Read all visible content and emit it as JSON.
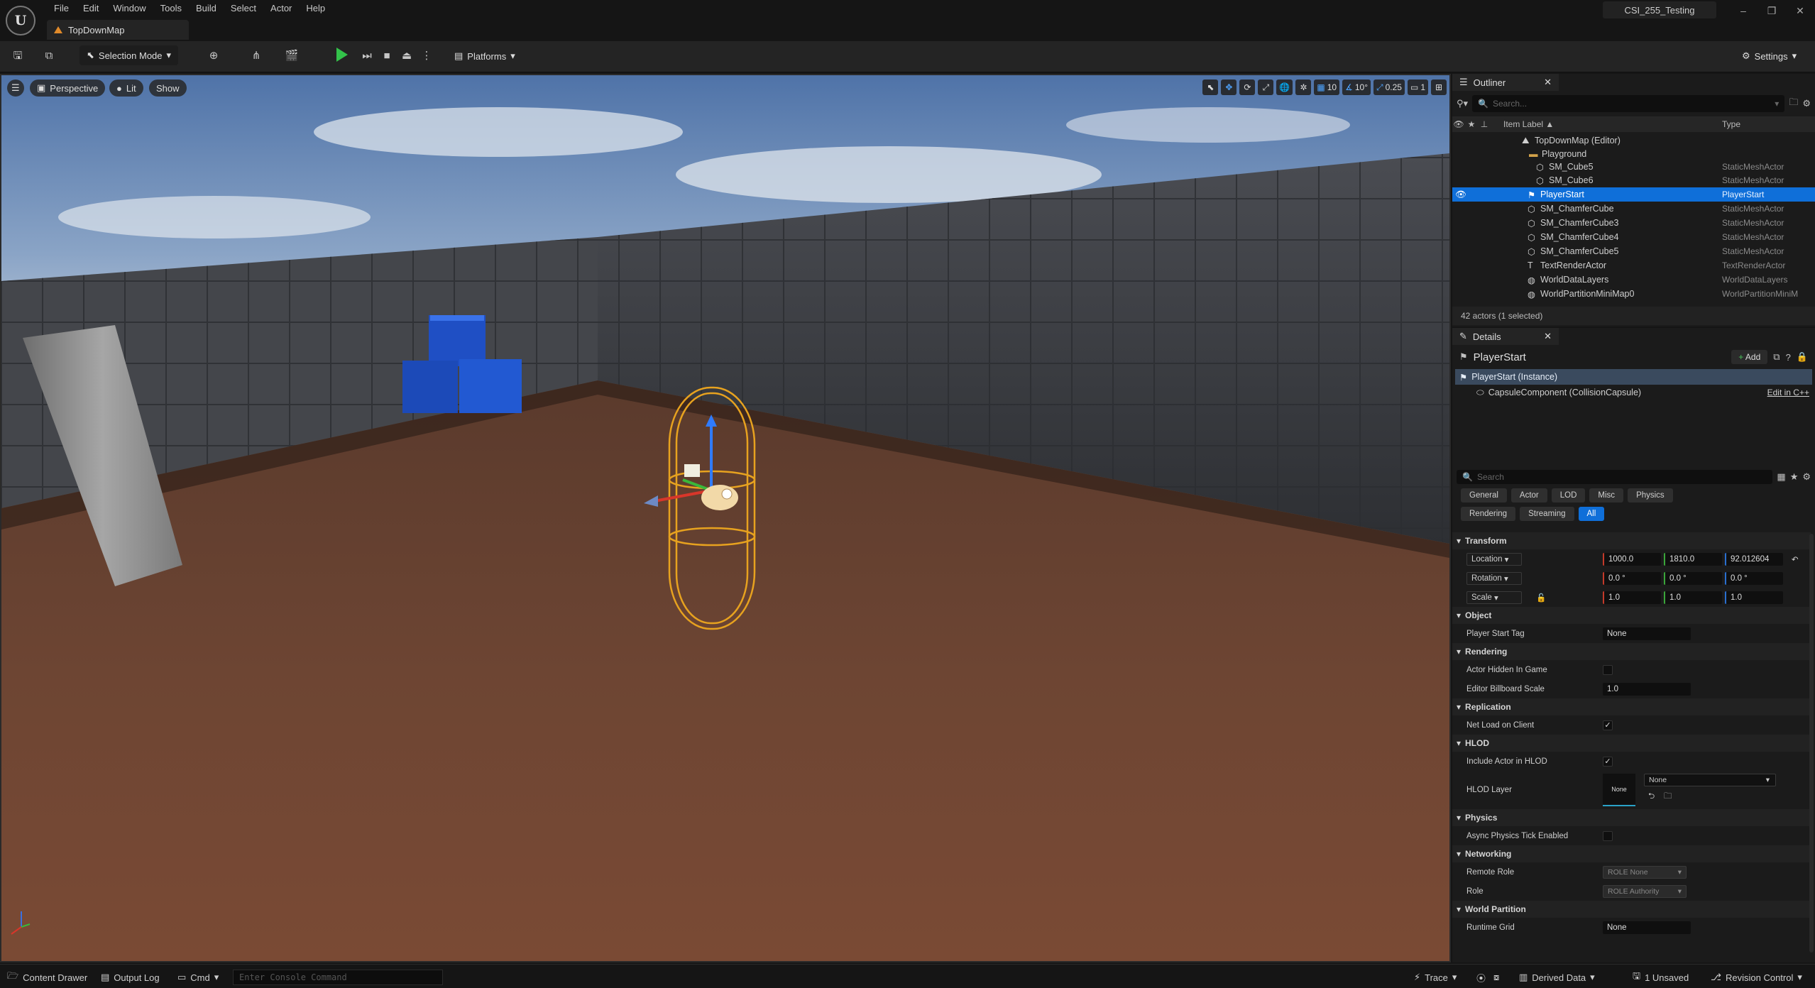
{
  "app": {
    "project_name": "CSI_255_Testing",
    "map_tab": "TopDownMap",
    "logo": "unreal-logo"
  },
  "menu": [
    "File",
    "Edit",
    "Window",
    "Tools",
    "Build",
    "Select",
    "Actor",
    "Help"
  ],
  "toolbar": {
    "selection_mode": "Selection Mode",
    "platforms": "Platforms",
    "settings": "Settings"
  },
  "viewport": {
    "view_mode": "Perspective",
    "lighting": "Lit",
    "show": "Show",
    "grid_snap": "10",
    "rot_snap": "10°",
    "scale_snap": "0.25",
    "camera_speed": "1"
  },
  "outliner": {
    "tab": "Outliner",
    "search_placeholder": "Search...",
    "col_label": "Item Label ▲",
    "col_type": "Type",
    "items": [
      {
        "label": "TopDownMap (Editor)",
        "type": ""
      },
      {
        "label": "Playground",
        "type": ""
      },
      {
        "label": "SM_Cube5",
        "type": "StaticMeshActor"
      },
      {
        "label": "SM_Cube6",
        "type": "StaticMeshActor"
      },
      {
        "label": "PlayerStart",
        "type": "PlayerStart"
      },
      {
        "label": "SM_ChamferCube",
        "type": "StaticMeshActor"
      },
      {
        "label": "SM_ChamferCube3",
        "type": "StaticMeshActor"
      },
      {
        "label": "SM_ChamferCube4",
        "type": "StaticMeshActor"
      },
      {
        "label": "SM_ChamferCube5",
        "type": "StaticMeshActor"
      },
      {
        "label": "TextRenderActor",
        "type": "TextRenderActor"
      },
      {
        "label": "WorldDataLayers",
        "type": "WorldDataLayers"
      },
      {
        "label": "WorldPartitionMiniMap0",
        "type": "WorldPartitionMiniM"
      }
    ],
    "footer": "42 actors (1 selected)"
  },
  "details": {
    "tab": "Details",
    "actor_name": "PlayerStart",
    "add_label": "Add",
    "instance": "PlayerStart (Instance)",
    "component": "CapsuleComponent (CollisionCapsule)",
    "edit_cpp": "Edit in C++",
    "search_placeholder": "Search",
    "filters": [
      "General",
      "Actor",
      "LOD",
      "Misc",
      "Physics",
      "Rendering",
      "Streaming",
      "All"
    ],
    "sections": {
      "transform": "Transform",
      "object": "Object",
      "rendering": "Rendering",
      "replication": "Replication",
      "hlod": "HLOD",
      "physics": "Physics",
      "networking": "Networking",
      "world_partition": "World Partition"
    },
    "location": {
      "label": "Location",
      "x": "1000.0",
      "y": "1810.0",
      "z": "92.012604"
    },
    "rotation": {
      "label": "Rotation",
      "x": "0.0 °",
      "y": "0.0 °",
      "z": "0.0 °"
    },
    "scale": {
      "label": "Scale",
      "x": "1.0",
      "y": "1.0",
      "z": "1.0"
    },
    "player_start_tag": {
      "label": "Player Start Tag",
      "value": "None"
    },
    "actor_hidden": {
      "label": "Actor Hidden In Game",
      "checked": false
    },
    "billboard_scale": {
      "label": "Editor Billboard Scale",
      "value": "1.0"
    },
    "net_load": {
      "label": "Net Load on Client",
      "checked": true
    },
    "include_hlod": {
      "label": "Include Actor in HLOD",
      "checked": true
    },
    "hlod_layer": {
      "label": "HLOD Layer",
      "thumb": "None",
      "value": "None"
    },
    "async_physics": {
      "label": "Async Physics Tick Enabled",
      "checked": false
    },
    "remote_role": {
      "label": "Remote Role",
      "value": "ROLE None"
    },
    "role": {
      "label": "Role",
      "value": "ROLE Authority"
    },
    "runtime_grid": {
      "label": "Runtime Grid",
      "value": "None"
    }
  },
  "statusbar": {
    "content_drawer": "Content Drawer",
    "output_log": "Output Log",
    "cmd": "Cmd",
    "console_placeholder": "Enter Console Command",
    "trace": "Trace",
    "derived_data": "Derived Data",
    "unsaved": "1 Unsaved",
    "revision_control": "Revision Control"
  },
  "colors": {
    "accent": "#0f6fd9",
    "play": "#33c24a",
    "cube": "#1f5fd8",
    "capsule": "#e7a21f"
  }
}
